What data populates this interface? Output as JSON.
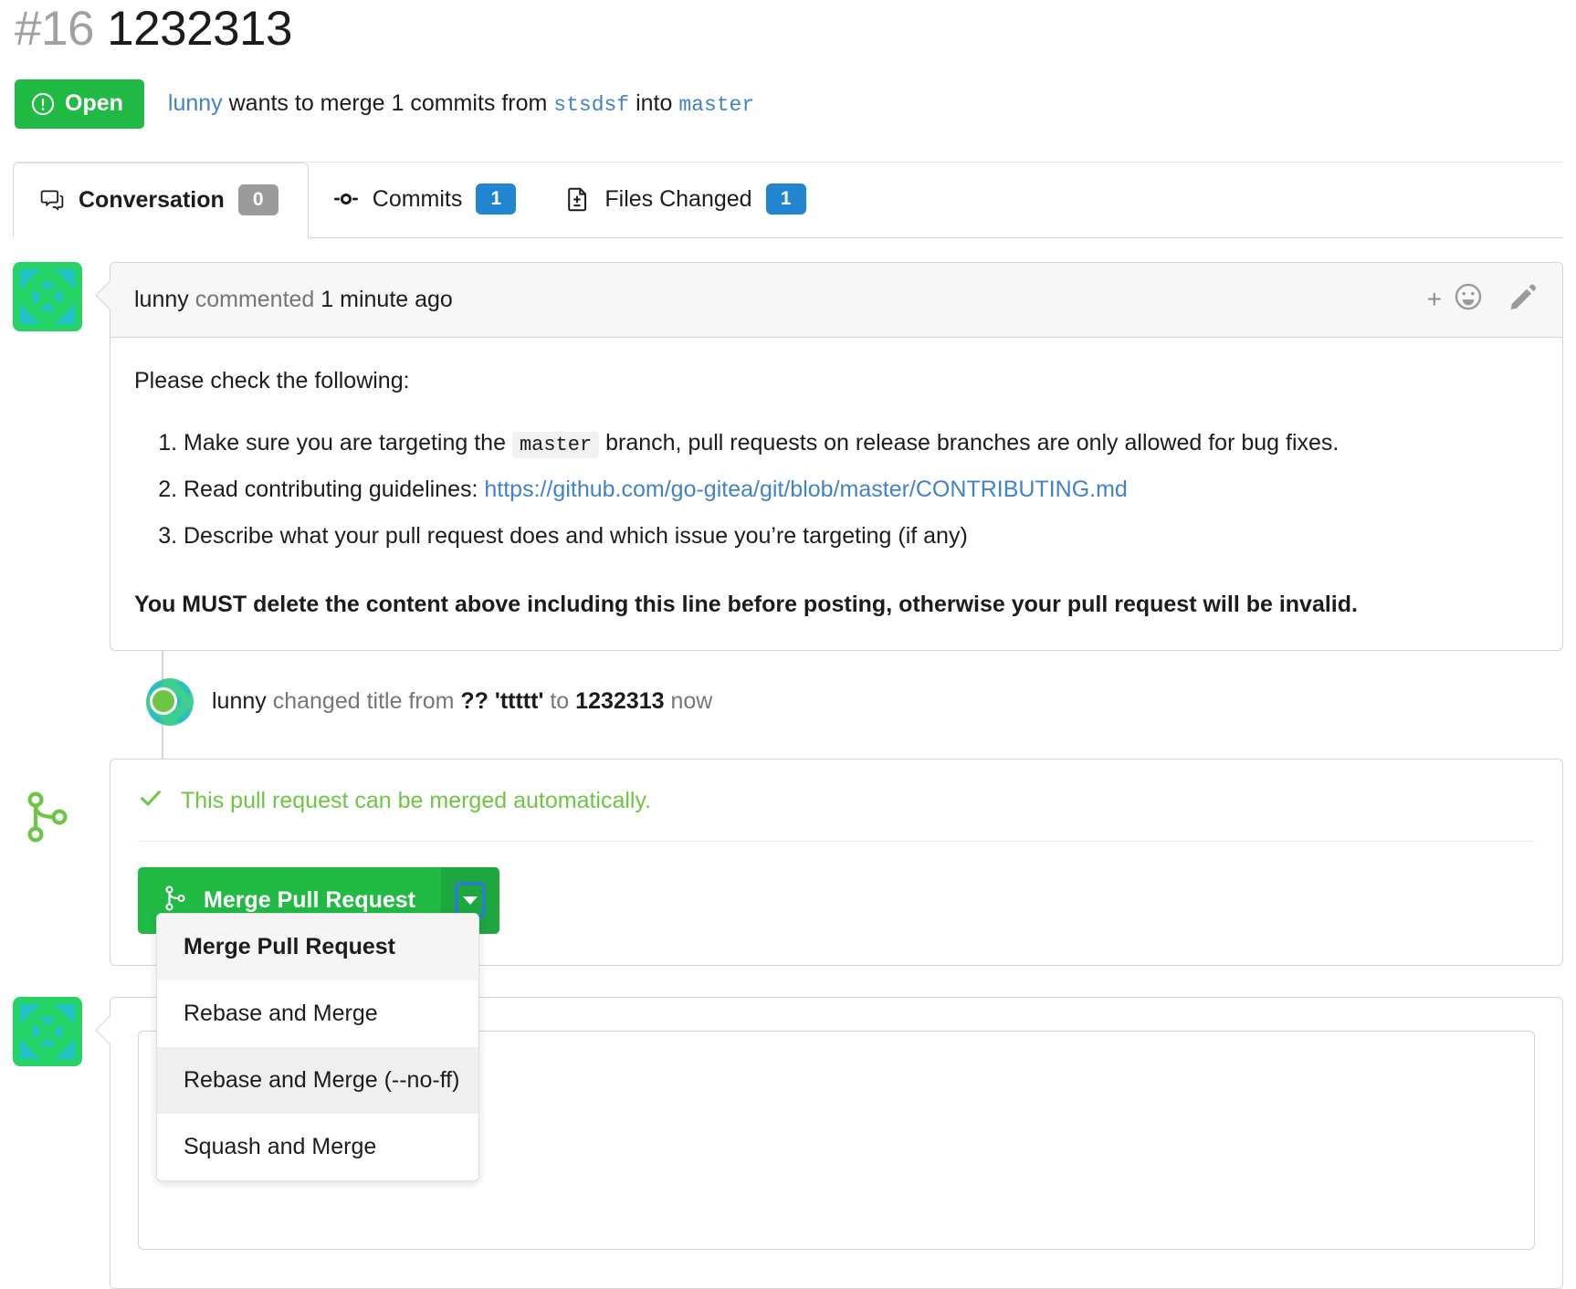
{
  "header": {
    "index": "#16",
    "title": "1232313",
    "state_label": "Open",
    "state_color": "#21ba45",
    "meta": {
      "author": "lunny",
      "action": "wants to merge 1 commits from",
      "head_branch": "stsdsf",
      "into": "into",
      "base_branch": "master"
    }
  },
  "tabs": [
    {
      "label": "Conversation",
      "count": "0",
      "icon": "comment-icon",
      "badge_color": "grey",
      "active": true
    },
    {
      "label": "Commits",
      "count": "1",
      "icon": "commit-icon",
      "badge_color": "blue",
      "active": false
    },
    {
      "label": "Files Changed",
      "count": "1",
      "icon": "file-diff-icon",
      "badge_color": "blue",
      "active": false
    }
  ],
  "comment": {
    "author": "lunny",
    "action": "commented",
    "time": "1 minute ago",
    "add_reaction_label": "+",
    "intro": "Please check the following:",
    "items": [
      {
        "before": "Make sure you are targeting the",
        "code": "master",
        "after": "branch, pull requests on release branches are only allowed for bug fixes."
      },
      {
        "before": "Read contributing guidelines:",
        "link": "https://github.com/go-gitea/git/blob/master/CONTRIBUTING.md",
        "after": ""
      },
      {
        "before": "Describe what your pull request does and which issue you’re targeting (if any)",
        "after": ""
      }
    ],
    "warning": "You MUST delete the content above including this line before posting, otherwise your pull request will be invalid."
  },
  "event": {
    "author": "lunny",
    "action": "changed title from",
    "old_title_prefix": "??",
    "old_title": "'ttttt'",
    "to": "to",
    "new_title": "1232313",
    "time": "now"
  },
  "merge": {
    "status_text": "This pull request can be merged automatically.",
    "status_color": "#6cc644",
    "button_label": "Merge Pull Request",
    "dropdown_options": [
      {
        "label": "Merge Pull Request",
        "selected": true,
        "hover": false
      },
      {
        "label": "Rebase and Merge",
        "selected": false,
        "hover": false
      },
      {
        "label": "Rebase and Merge (--no-ff)",
        "selected": false,
        "hover": true
      },
      {
        "label": "Squash and Merge",
        "selected": false,
        "hover": false
      }
    ]
  }
}
